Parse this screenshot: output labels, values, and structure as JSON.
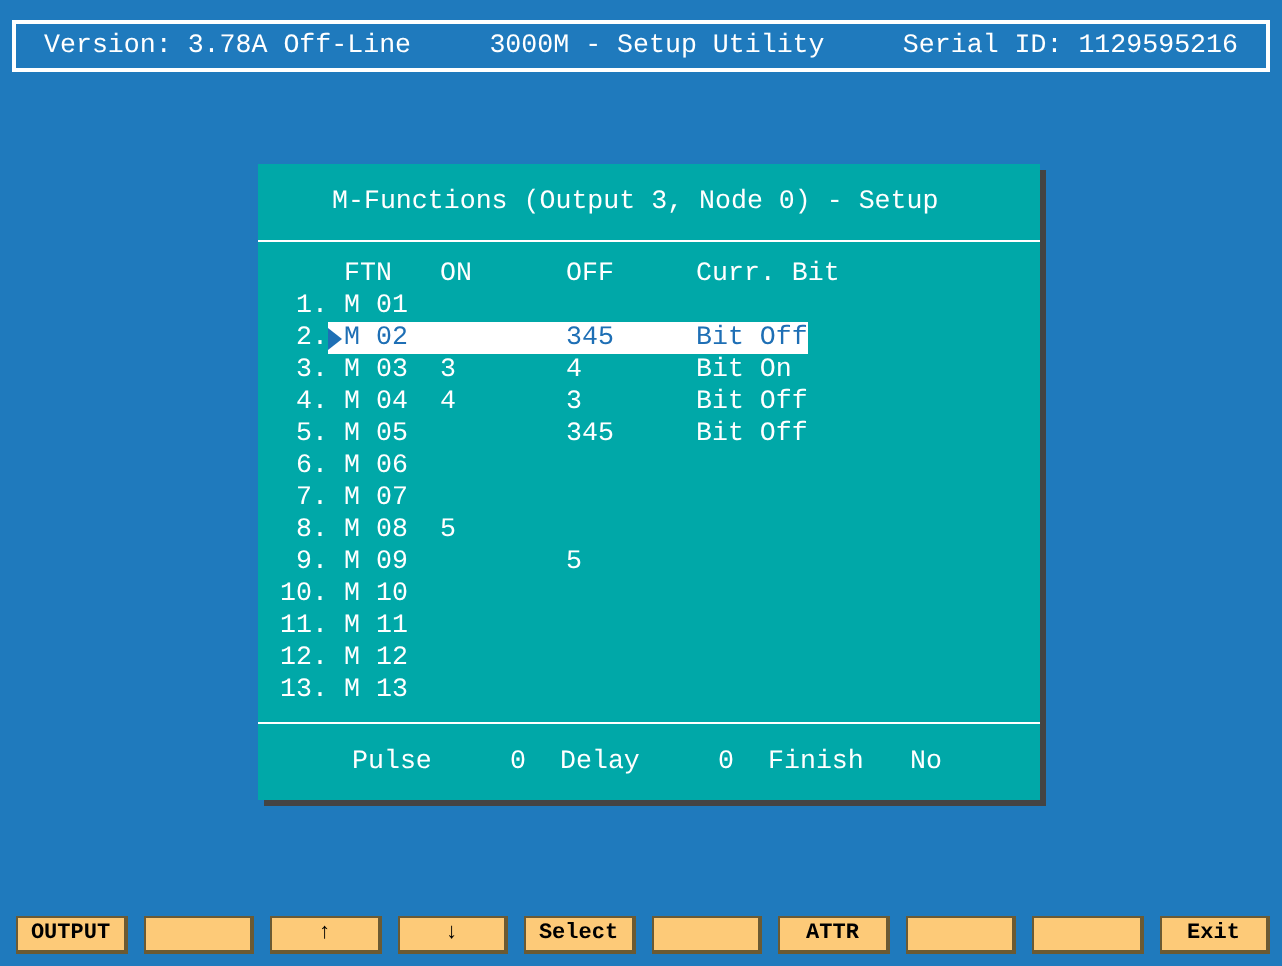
{
  "header": {
    "version": "Version: 3.78A Off-Line",
    "title": "3000M - Setup Utility",
    "serial": "Serial ID: 1129595216"
  },
  "dialog": {
    "title": "M-Functions (Output 3, Node 0) - Setup",
    "columns": [
      "FTN",
      "ON",
      "OFF",
      "Curr. Bit"
    ],
    "rows": [
      {
        "number": "1.",
        "ftn": "M 01",
        "selected": false
      },
      {
        "number": "2.",
        "ftn": "M 02",
        "off": "345",
        "bit": "Bit Off",
        "selected": true
      },
      {
        "number": "3.",
        "ftn": "M 03",
        "on": "3",
        "off": "4",
        "bit": "Bit On",
        "selected": false
      },
      {
        "number": "4.",
        "ftn": "M 04",
        "on": "4",
        "off": "3",
        "bit": "Bit Off",
        "selected": false
      },
      {
        "number": "5.",
        "ftn": "M 05",
        "off": "345",
        "bit": "Bit Off",
        "selected": false
      },
      {
        "number": "6.",
        "ftn": "M 06",
        "selected": false
      },
      {
        "number": "7.",
        "ftn": "M 07",
        "selected": false
      },
      {
        "number": "8.",
        "ftn": "M 08",
        "on": "5",
        "selected": false
      },
      {
        "number": "9.",
        "ftn": "M 09",
        "off": "5",
        "selected": false
      },
      {
        "number": "10.",
        "ftn": "M 10",
        "selected": false
      },
      {
        "number": "11.",
        "ftn": "M 11",
        "selected": false
      },
      {
        "number": "12.",
        "ftn": "M 12",
        "selected": false
      },
      {
        "number": "13.",
        "ftn": "M 13",
        "selected": false
      }
    ],
    "footer": [
      {
        "label": "Pulse",
        "value": "0"
      },
      {
        "label": "Delay",
        "value": "0"
      },
      {
        "label": "Finish",
        "value": "No"
      }
    ]
  },
  "keys": [
    {
      "kind": "label",
      "label": "OUTPUT"
    },
    {
      "kind": "blank"
    },
    {
      "kind": "label",
      "label": "↑"
    },
    {
      "kind": "label",
      "label": "↓"
    },
    {
      "kind": "label",
      "label": "Select"
    },
    {
      "kind": "blank"
    },
    {
      "kind": "label",
      "label": "ATTR"
    },
    {
      "kind": "blank"
    },
    {
      "kind": "blank"
    },
    {
      "kind": "label",
      "label": "Exit"
    }
  ]
}
